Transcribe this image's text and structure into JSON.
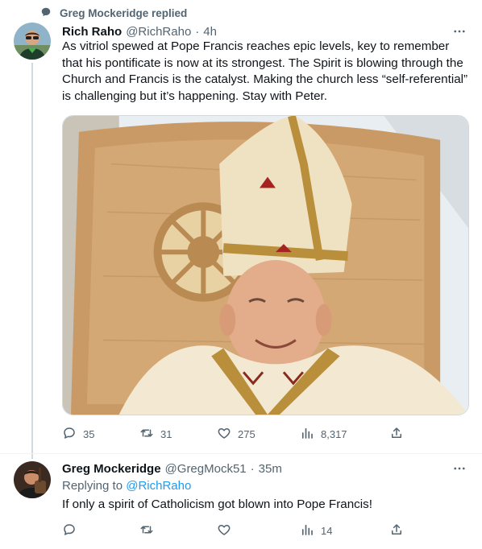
{
  "context": {
    "text": "Greg Mockeridge replied",
    "icon": "speech-bubble-icon"
  },
  "tweet": {
    "author_name": "Rich Raho",
    "handle": "@RichRaho",
    "separator": "·",
    "time": "4h",
    "text": "As vitriol spewed at Pope Francis reaches epic levels, key to remember that his pontificate is now at its strongest. The Spirit is blowing through the Church and Francis is the catalyst. Making the church less “self-referential” is challenging but it’s happening. Stay with Peter.",
    "stats": {
      "replies": "35",
      "retweets": "31",
      "likes": "275",
      "views": "8,317"
    }
  },
  "reply": {
    "author_name": "Greg Mockeridge",
    "handle": "@GregMock51",
    "separator": "·",
    "time": "35m",
    "replying_prefix": "Replying to ",
    "replying_to": "@RichRaho",
    "text": "If only a spirit of Catholicism got blown into Pope Francis!",
    "stats": {
      "replies": "",
      "retweets": "",
      "likes": "",
      "views": "14"
    }
  },
  "colors": {
    "text": "#0f1419",
    "secondary": "#536471",
    "link": "#1d9bf0",
    "line": "#cfd9de"
  }
}
